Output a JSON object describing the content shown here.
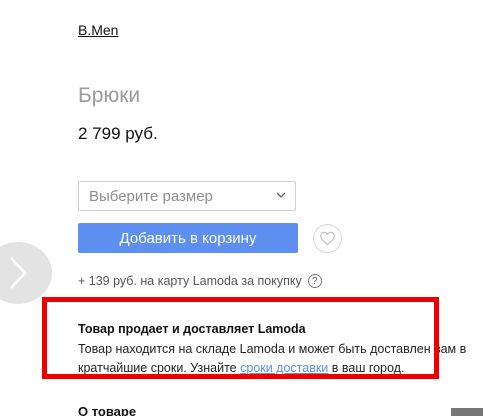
{
  "product": {
    "brand": "B.Men",
    "title": "Брюки",
    "price": "2 799 руб."
  },
  "size_select": {
    "placeholder": "Выберите размер"
  },
  "actions": {
    "add_to_cart": "Добавить в корзину"
  },
  "bonus": {
    "text": "+ 139 руб. на карту Lamoda за покупку",
    "help_glyph": "?"
  },
  "seller": {
    "title": "Товар продает и доставляет Lamoda",
    "text_part1": "Товар находится на складе Lamoda и может быть доставлен вам в кратчайшие сроки. Узнайте ",
    "link": "сроки доставки",
    "text_part2": " в ваш город."
  },
  "about": {
    "heading": "О товаре"
  },
  "colors": {
    "accent": "#5c8ff0",
    "highlight": "#ee0000"
  }
}
